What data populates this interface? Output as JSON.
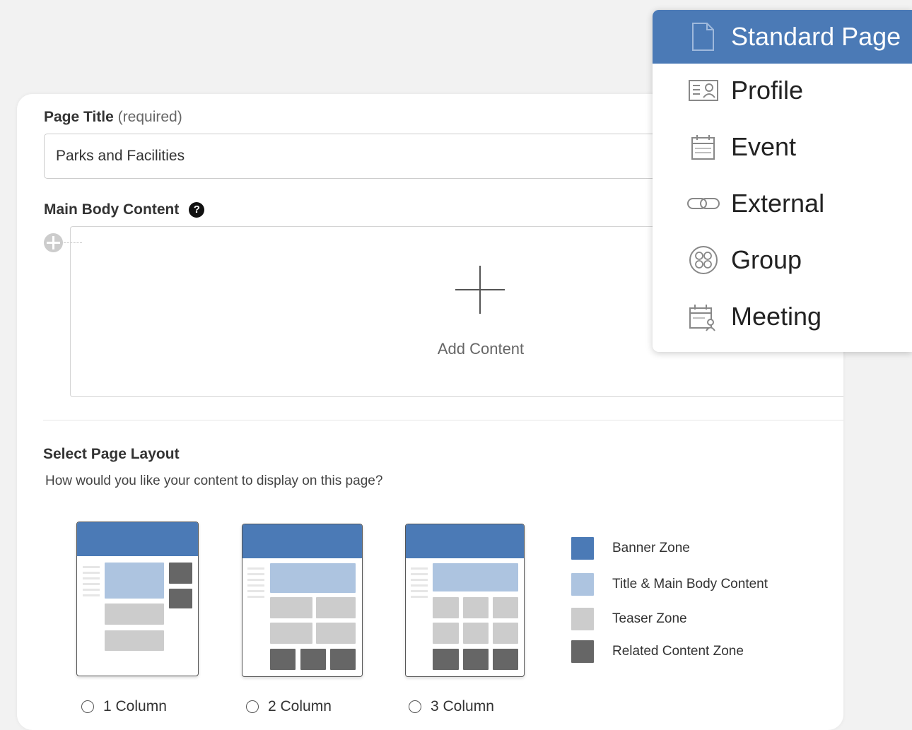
{
  "form": {
    "page_title_label": "Page Title",
    "page_title_required": "(required)",
    "page_title_value": "Parks and Facilities",
    "main_body_label": "Main Body Content",
    "help_glyph": "?",
    "add_content_label": "Add Content",
    "layout_heading": "Select Page Layout",
    "layout_subtext": "How would you like your content to display on this page?"
  },
  "layouts": [
    {
      "label": "1 Column",
      "selected": false
    },
    {
      "label": "2 Column",
      "selected": false
    },
    {
      "label": "3 Column",
      "selected": false
    }
  ],
  "legend": [
    {
      "label": "Banner Zone",
      "color": "#4b7ab6"
    },
    {
      "label": "Title & Main Body Content",
      "color": "#adc4e0"
    },
    {
      "label": "Teaser Zone",
      "color": "#cccccc"
    },
    {
      "label": "Related Content Zone",
      "color": "#666666"
    }
  ],
  "menu": {
    "items": [
      {
        "label": "Standard Page",
        "icon": "document-icon",
        "active": true
      },
      {
        "label": "Profile",
        "icon": "profile-card-icon",
        "active": false
      },
      {
        "label": "Event",
        "icon": "calendar-icon",
        "active": false
      },
      {
        "label": "External",
        "icon": "link-icon",
        "active": false
      },
      {
        "label": "Group",
        "icon": "group-icon",
        "active": false
      },
      {
        "label": "Meeting",
        "icon": "meeting-icon",
        "active": false
      }
    ]
  },
  "colors": {
    "accent": "#4b7ab6"
  }
}
